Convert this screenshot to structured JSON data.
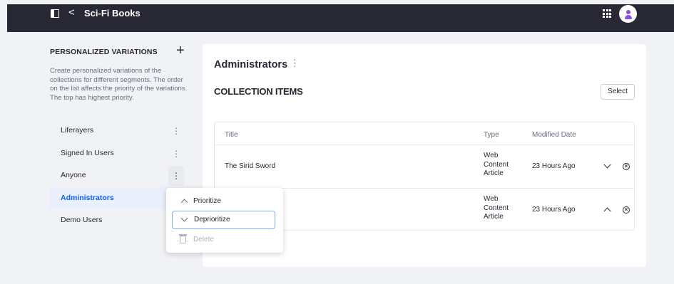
{
  "topbar": {
    "back_glyph": "<",
    "title": "Sci-Fi Books",
    "panel_icon": "panel-toggle-icon",
    "apps_icon": "apps-grid-icon",
    "avatar_icon": "user-avatar-icon"
  },
  "sidebar": {
    "title": "PERSONALIZED VARIATIONS",
    "add_glyph": "+",
    "description": "Create personalized variations of the collections for different segments. The order on the list affects the priority of the variations. The top has highest priority.",
    "items": [
      {
        "label": "Liferayers"
      },
      {
        "label": "Signed In Users"
      },
      {
        "label": "Anyone"
      },
      {
        "label": "Administrators",
        "active": true
      },
      {
        "label": "Demo Users"
      }
    ],
    "kebab_glyph": "⋮"
  },
  "main": {
    "title": "Administrators",
    "collection_title": "COLLECTION ITEMS",
    "select_label": "Select",
    "table": {
      "columns": [
        "Title",
        "Type",
        "Modified Date"
      ],
      "rows": [
        {
          "title": "The Sirid Sword",
          "type": [
            "Web",
            "Content",
            "Article"
          ],
          "modified": "23 Hours Ago"
        },
        {
          "title": "",
          "type": [
            "Web",
            "Content",
            "Article"
          ],
          "modified": "23 Hours Ago"
        }
      ]
    }
  },
  "dropdown": {
    "items": [
      {
        "label": "Prioritize"
      },
      {
        "label": "Deprioritize"
      },
      {
        "label": "Delete"
      }
    ]
  },
  "colors": {
    "topbar": "#272833",
    "accent": "#0b5fff",
    "focus_ring": "#80acff",
    "avatar_purple": "#8a4fe8"
  }
}
